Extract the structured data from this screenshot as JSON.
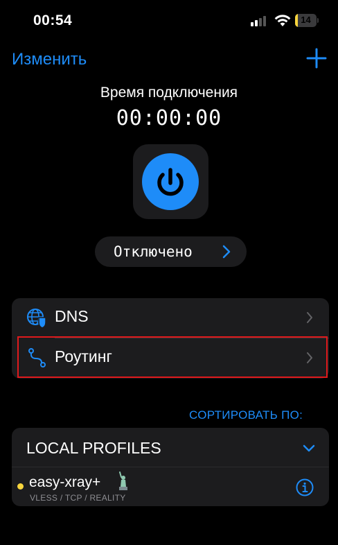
{
  "status_bar": {
    "time": "00:54",
    "battery": "14",
    "battery_level": 0.14
  },
  "nav": {
    "edit_label": "Изменить"
  },
  "connection": {
    "label": "Время подключения",
    "timer": "00:00:00",
    "state_label": "Отключено"
  },
  "settings": {
    "items": [
      {
        "label": "DNS"
      },
      {
        "label": "Роутинг"
      }
    ]
  },
  "sort": {
    "label": "СОРТИРОВАТЬ ПО:"
  },
  "profiles": {
    "title": "LOCAL PROFILES",
    "items": [
      {
        "name": "easy-xray+",
        "meta": "VLESS / TCP / REALITY"
      }
    ]
  },
  "colors": {
    "accent": "#1e8cf8",
    "highlight": "#e0191c",
    "status_dot": "#f8d53d"
  }
}
